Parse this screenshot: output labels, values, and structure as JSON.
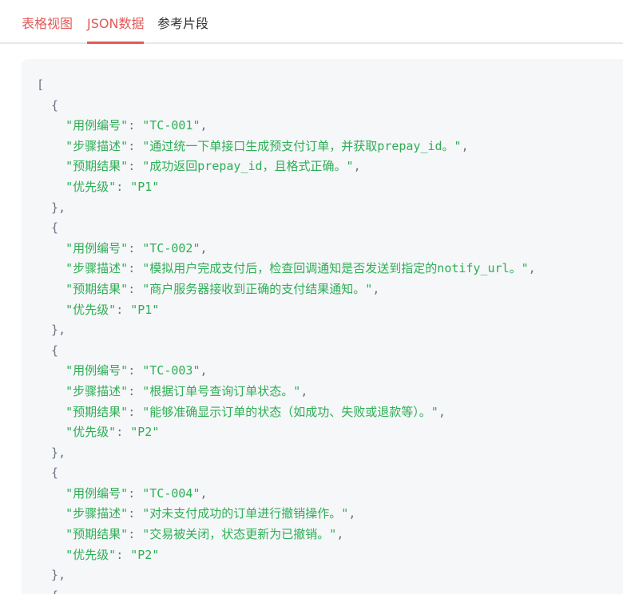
{
  "tabs": [
    {
      "label": "表格视图",
      "active": false
    },
    {
      "label": "JSON数据",
      "active": true
    },
    {
      "label": "参考片段",
      "active": false
    }
  ],
  "colors": {
    "accent": "#e15a5a",
    "code_string": "#2eae55",
    "code_punctuation": "#6b7280",
    "panel_bg": "#f6f7f9"
  },
  "json_keys": {
    "id": "用例编号",
    "steps": "步骤描述",
    "expected": "预期结果",
    "priority": "优先级"
  },
  "test_cases": [
    {
      "id": "TC-001",
      "steps": "通过统一下单接口生成预支付订单，并获取prepay_id。",
      "expected": "成功返回prepay_id，且格式正确。",
      "priority": "P1"
    },
    {
      "id": "TC-002",
      "steps": "模拟用户完成支付后，检查回调通知是否发送到指定的notify_url。",
      "expected": "商户服务器接收到正确的支付结果通知。",
      "priority": "P1"
    },
    {
      "id": "TC-003",
      "steps": "根据订单号查询订单状态。",
      "expected": "能够准确显示订单的状态（如成功、失败或退款等）。",
      "priority": "P2"
    },
    {
      "id": "TC-004",
      "steps": "对未支付成功的订单进行撤销操作。",
      "expected": "交易被关闭，状态更新为已撤销。",
      "priority": "P2"
    }
  ]
}
